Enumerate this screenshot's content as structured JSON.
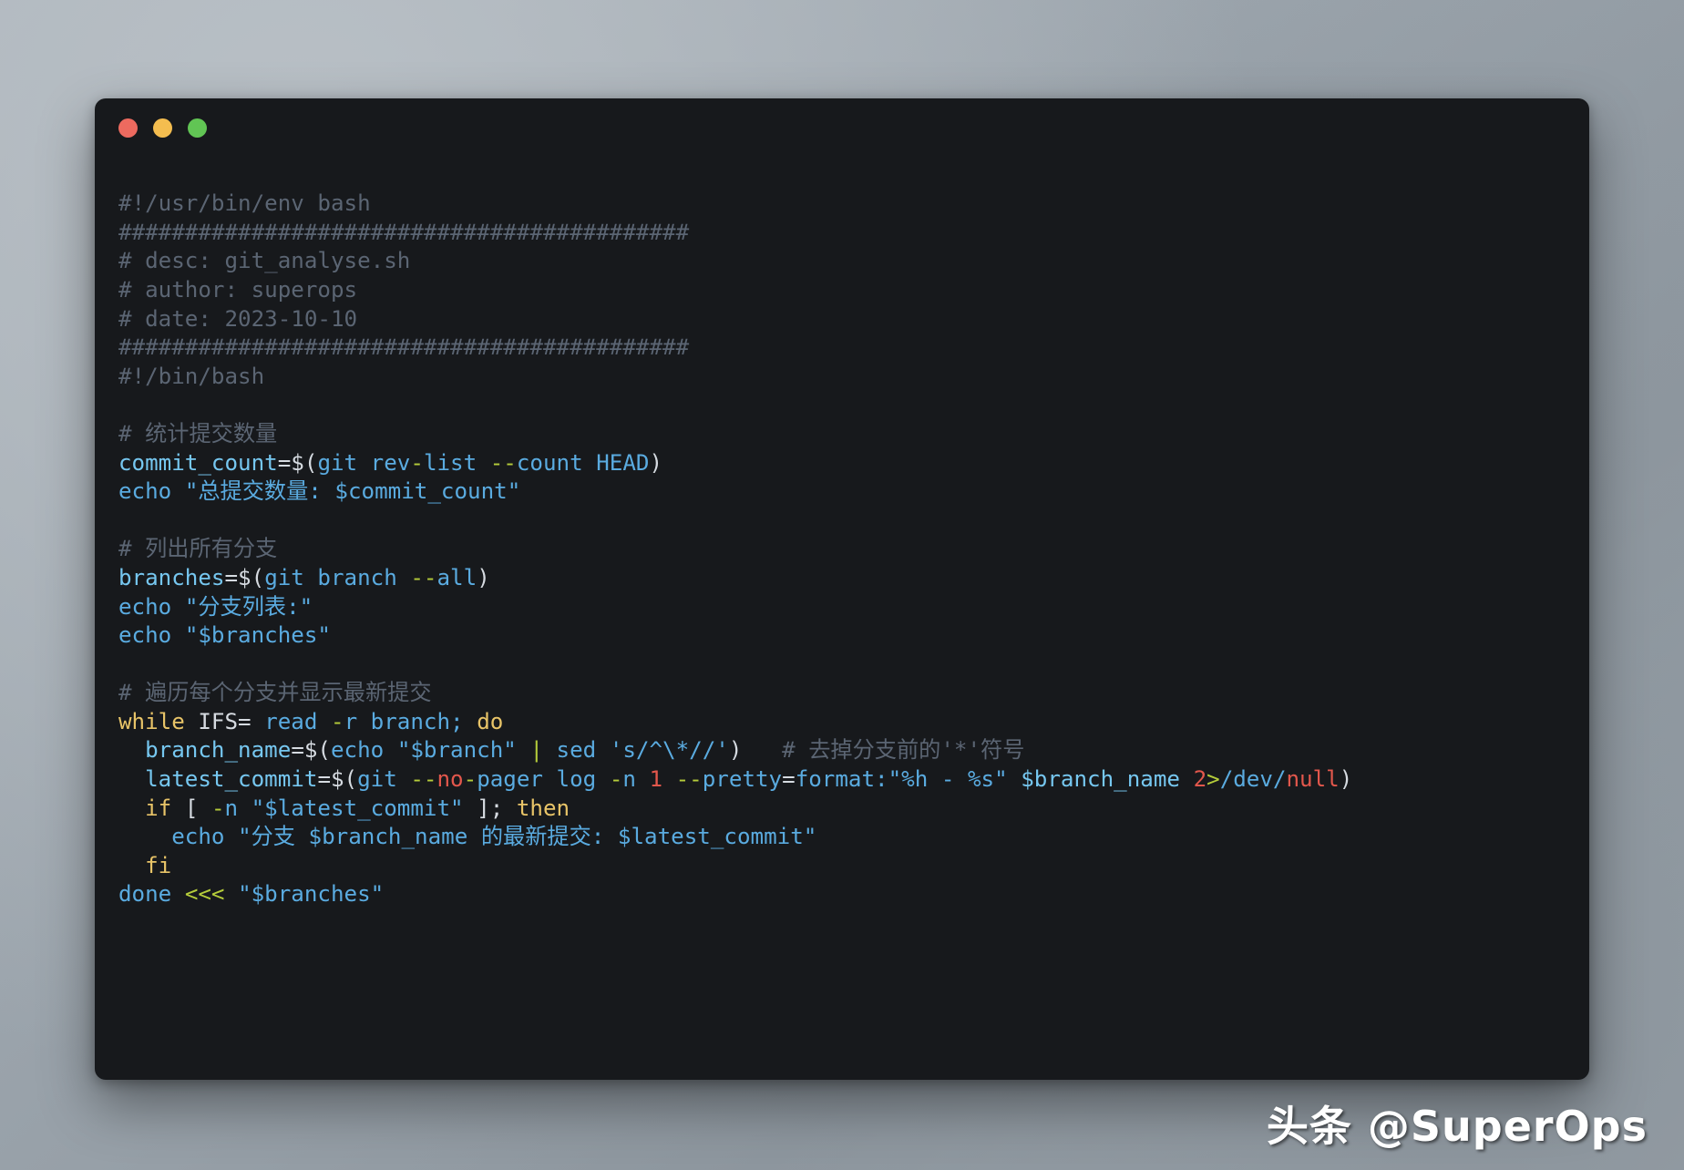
{
  "window": {
    "traffic_lights": [
      {
        "name": "close-button",
        "color": "#ed6a5f"
      },
      {
        "name": "minimize-button",
        "color": "#f4bd4f"
      },
      {
        "name": "maximize-button",
        "color": "#61c554"
      }
    ]
  },
  "watermark": {
    "text": "头条 @SuperOps"
  },
  "code": {
    "language": "bash",
    "lines": [
      [
        {
          "t": "#!/usr/bin/env bash",
          "c": "cmt"
        }
      ],
      [
        {
          "t": "###########################################",
          "c": "cmt"
        }
      ],
      [
        {
          "t": "# desc: git_analyse.sh",
          "c": "cmt"
        }
      ],
      [
        {
          "t": "# author: superops",
          "c": "cmt"
        }
      ],
      [
        {
          "t": "# date: 2023-10-10",
          "c": "cmt"
        }
      ],
      [
        {
          "t": "###########################################",
          "c": "cmt"
        }
      ],
      [
        {
          "t": "#!/bin/bash",
          "c": "cmt"
        }
      ],
      [],
      [
        {
          "t": "# 统计提交数量",
          "c": "cmt"
        }
      ],
      [
        {
          "t": "commit_count",
          "c": "var"
        },
        {
          "t": "=$(",
          "c": "plain"
        },
        {
          "t": "git rev",
          "c": "cmd"
        },
        {
          "t": "-",
          "c": "op"
        },
        {
          "t": "list ",
          "c": "cmd"
        },
        {
          "t": "--",
          "c": "op"
        },
        {
          "t": "count HEAD",
          "c": "cmd"
        },
        {
          "t": ")",
          "c": "plain"
        }
      ],
      [
        {
          "t": "echo ",
          "c": "cmd"
        },
        {
          "t": "\"总提交数量: $commit_count\"",
          "c": "str"
        }
      ],
      [],
      [
        {
          "t": "# 列出所有分支",
          "c": "cmt"
        }
      ],
      [
        {
          "t": "branches",
          "c": "var"
        },
        {
          "t": "=$(",
          "c": "plain"
        },
        {
          "t": "git branch ",
          "c": "cmd"
        },
        {
          "t": "--",
          "c": "op"
        },
        {
          "t": "all",
          "c": "cmd"
        },
        {
          "t": ")",
          "c": "plain"
        }
      ],
      [
        {
          "t": "echo ",
          "c": "cmd"
        },
        {
          "t": "\"分支列表:\"",
          "c": "str"
        }
      ],
      [
        {
          "t": "echo ",
          "c": "cmd"
        },
        {
          "t": "\"$branches\"",
          "c": "str"
        }
      ],
      [],
      [
        {
          "t": "# 遍历每个分支并显示最新提交",
          "c": "cmt"
        }
      ],
      [
        {
          "t": "while ",
          "c": "kw"
        },
        {
          "t": "IFS= ",
          "c": "plain"
        },
        {
          "t": "read ",
          "c": "cmd"
        },
        {
          "t": "-",
          "c": "op"
        },
        {
          "t": "r branch; ",
          "c": "cmd"
        },
        {
          "t": "do",
          "c": "kw"
        }
      ],
      [
        {
          "t": "  ",
          "c": "plain"
        },
        {
          "t": "branch_name",
          "c": "var"
        },
        {
          "t": "=$(",
          "c": "plain"
        },
        {
          "t": "echo ",
          "c": "cmd"
        },
        {
          "t": "\"$branch\"",
          "c": "str"
        },
        {
          "t": " ",
          "c": "plain"
        },
        {
          "t": "|",
          "c": "op"
        },
        {
          "t": " sed ",
          "c": "cmd"
        },
        {
          "t": "'s/^\\*//'",
          "c": "str"
        },
        {
          "t": ")",
          "c": "plain"
        },
        {
          "t": "   ",
          "c": "plain"
        },
        {
          "t": "# 去掉分支前的'*'符号",
          "c": "cmt"
        }
      ],
      [
        {
          "t": "  ",
          "c": "plain"
        },
        {
          "t": "latest_commit",
          "c": "var"
        },
        {
          "t": "=$(",
          "c": "plain"
        },
        {
          "t": "git ",
          "c": "cmd"
        },
        {
          "t": "--",
          "c": "op"
        },
        {
          "t": "no",
          "c": "red"
        },
        {
          "t": "-",
          "c": "op"
        },
        {
          "t": "pager log ",
          "c": "cmd"
        },
        {
          "t": "-",
          "c": "op"
        },
        {
          "t": "n ",
          "c": "cmd"
        },
        {
          "t": "1",
          "c": "num"
        },
        {
          "t": " ",
          "c": "plain"
        },
        {
          "t": "--",
          "c": "op"
        },
        {
          "t": "pretty",
          "c": "cmd"
        },
        {
          "t": "=",
          "c": "plain"
        },
        {
          "t": "format:\"%h - %s\"",
          "c": "str"
        },
        {
          "t": " ",
          "c": "plain"
        },
        {
          "t": "$branch_name",
          "c": "var"
        },
        {
          "t": " ",
          "c": "plain"
        },
        {
          "t": "2",
          "c": "num"
        },
        {
          "t": ">",
          "c": "op"
        },
        {
          "t": "/dev/",
          "c": "cmd"
        },
        {
          "t": "null",
          "c": "red"
        },
        {
          "t": ")",
          "c": "plain"
        }
      ],
      [
        {
          "t": "  ",
          "c": "plain"
        },
        {
          "t": "if ",
          "c": "kw"
        },
        {
          "t": "[ ",
          "c": "plain"
        },
        {
          "t": "-",
          "c": "op"
        },
        {
          "t": "n ",
          "c": "cmd"
        },
        {
          "t": "\"$latest_commit\"",
          "c": "str"
        },
        {
          "t": " ]; ",
          "c": "plain"
        },
        {
          "t": "then",
          "c": "kw"
        }
      ],
      [
        {
          "t": "    ",
          "c": "plain"
        },
        {
          "t": "echo ",
          "c": "cmd"
        },
        {
          "t": "\"分支 $branch_name 的最新提交: $latest_commit\"",
          "c": "str"
        }
      ],
      [
        {
          "t": "  ",
          "c": "plain"
        },
        {
          "t": "fi",
          "c": "kw"
        }
      ],
      [
        {
          "t": "done ",
          "c": "cmd"
        },
        {
          "t": "<<<",
          "c": "op"
        },
        {
          "t": " ",
          "c": "plain"
        },
        {
          "t": "\"$branches\"",
          "c": "str"
        }
      ]
    ]
  }
}
